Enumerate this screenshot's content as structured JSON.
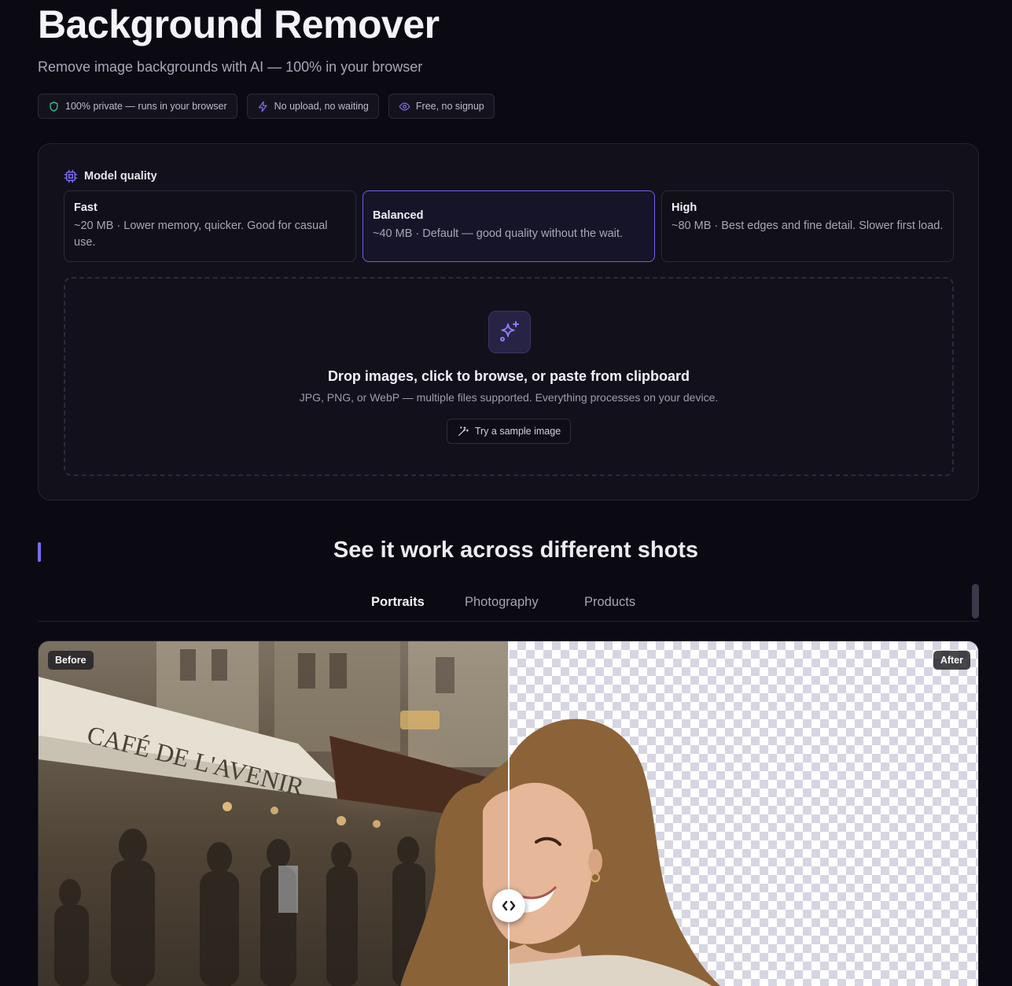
{
  "header": {
    "title": "Background Remover",
    "subtitle": "Remove image backgrounds with AI — 100% in your browser"
  },
  "pills": [
    {
      "icon": "shield-icon",
      "label": "100% private — runs in your browser"
    },
    {
      "icon": "lightning-icon",
      "label": "No upload, no waiting"
    },
    {
      "icon": "eye-icon",
      "label": "Free, no signup"
    }
  ],
  "model_quality": {
    "label": "Model quality",
    "options": [
      {
        "name": "Fast",
        "desc": "~20 MB · Lower memory, quicker. Good for casual use."
      },
      {
        "name": "Balanced",
        "desc": "~40 MB · Default — good quality without the wait.",
        "selected": true
      },
      {
        "name": "High",
        "desc": "~80 MB · Best edges and fine detail. Slower first load."
      }
    ]
  },
  "dropzone": {
    "title": "Drop images, click to browse, or paste from clipboard",
    "subtitle": "JPG, PNG, or WebP — multiple files supported. Everything processes on your device.",
    "sample_button": "Try a sample image"
  },
  "section": {
    "title": "See it work across different shots",
    "tabs": [
      "Portraits",
      "Photography",
      "Products"
    ],
    "active_tab": "Portraits"
  },
  "compare": {
    "before_label": "Before",
    "after_label": "After",
    "split": 0.5,
    "cafe_sign": "CAFÉ DE L'AVENIR"
  },
  "colors": {
    "accent": "#7b6cf0",
    "background": "#0b0a13"
  }
}
